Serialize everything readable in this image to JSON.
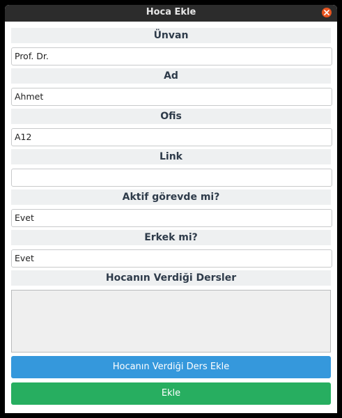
{
  "window": {
    "title": "Hoca Ekle"
  },
  "form": {
    "title_label": "Ünvan",
    "title_value": "Prof. Dr.",
    "name_label": "Ad",
    "name_value": "Ahmet",
    "office_label": "Ofis",
    "office_value": "A12",
    "link_label": "Link",
    "link_value": "",
    "active_label": "Aktif görevde mi?",
    "active_value": "Evet",
    "male_label": "Erkek mi?",
    "male_value": "Evet",
    "courses_label": "Hocanın Verdiği Dersler",
    "courses": []
  },
  "buttons": {
    "add_course": "Hocanın Verdiği Ders Ekle",
    "add": "Ekle"
  },
  "colors": {
    "blue_button": "#3598dc",
    "green_button": "#27ae60",
    "close_button": "#e9541f"
  },
  "icons": {
    "close": "close-icon"
  }
}
